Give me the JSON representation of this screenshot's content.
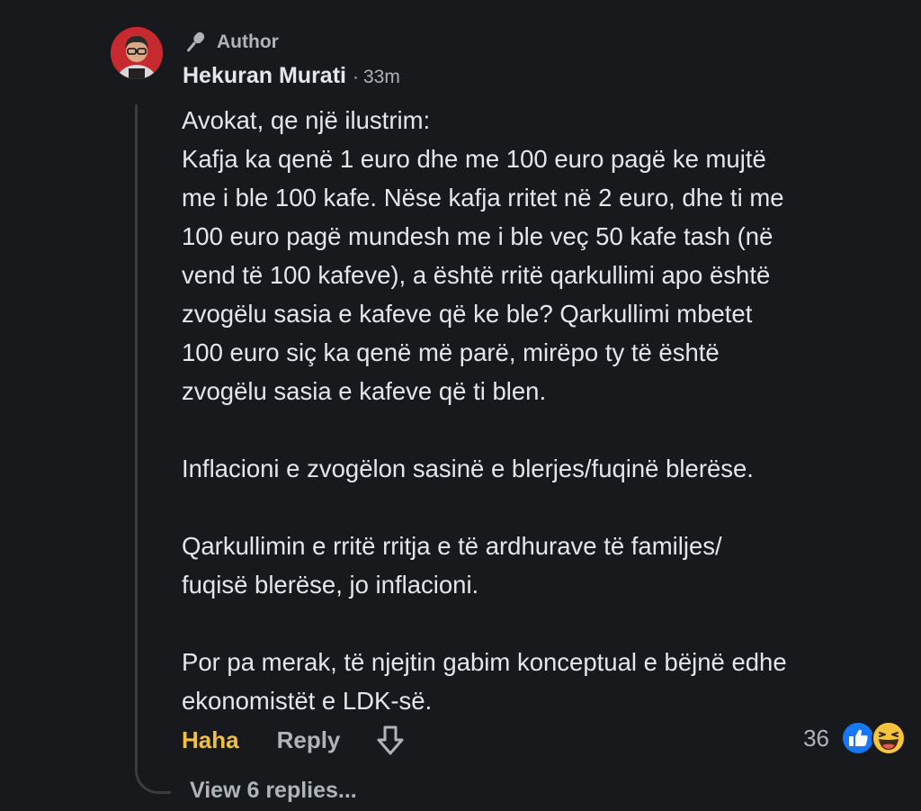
{
  "comment": {
    "badge_label": "Author",
    "author_name": "Hekuran Murati",
    "separator": "·",
    "time": "33m",
    "paragraphs": [
      [
        "Avokat, qe një ilustrim:",
        "Kafja ka qenë 1 euro dhe me 100 euro pagë ke mujtë",
        "me i ble 100 kafe. Nëse kafja rritet në 2 euro, dhe ti me",
        "100 euro pagë mundesh me i ble veç 50 kafe tash (në",
        "vend të 100 kafeve), a është rritë qarkullimi apo është",
        "zvogëlu sasia e kafeve që ke ble? Qarkullimi mbetet",
        "100 euro siç ka qenë më parë, mirëpo ty të është",
        "zvogëlu sasia e kafeve që ti blen."
      ],
      [
        "Inflacioni e zvogëlon sasinë e blerjes/fuqinë blerëse."
      ],
      [
        "Qarkullimin e rritë rritja e të ardhurave të familjes/",
        "fuqisë blerëse, jo inflacioni."
      ],
      [
        "Por pa merak, të njejtin gabim konceptual e bëjnë edhe",
        "ekonomistët e LDK-së."
      ]
    ],
    "actions": {
      "haha_label": "Haha",
      "reply_label": "Reply"
    },
    "reactions": {
      "count": "36",
      "types": [
        "like-icon",
        "haha-icon"
      ]
    },
    "view_replies_label": "View 6 replies..."
  },
  "colors": {
    "background": "#18191d",
    "text_primary": "#e4e6eb",
    "text_secondary": "#b0b3b8",
    "haha_accent": "#f0c040",
    "like_blue": "#1877f2"
  }
}
